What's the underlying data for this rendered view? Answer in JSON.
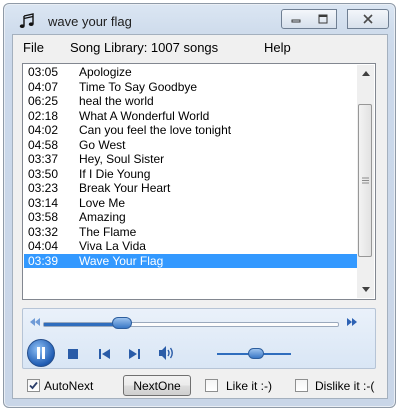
{
  "window": {
    "title": "wave your flag",
    "app_icon": "music-notes-icon"
  },
  "menu": {
    "file": "File",
    "song_library": "Song Library: 1007 songs",
    "help": "Help"
  },
  "playlist": {
    "rows": [
      {
        "duration": "03:05",
        "title": "Apologize"
      },
      {
        "duration": "04:07",
        "title": "Time To Say Goodbye"
      },
      {
        "duration": "06:25",
        "title": "heal the world"
      },
      {
        "duration": "02:18",
        "title": "What A Wonderful World"
      },
      {
        "duration": "04:02",
        "title": "Can you feel the love tonight"
      },
      {
        "duration": "04:58",
        "title": "Go West"
      },
      {
        "duration": "03:37",
        "title": "Hey, Soul Sister"
      },
      {
        "duration": "03:50",
        "title": "If I Die Young"
      },
      {
        "duration": "03:23",
        "title": "Break Your Heart"
      },
      {
        "duration": "03:14",
        "title": "Love Me"
      },
      {
        "duration": "03:58",
        "title": "Amazing"
      },
      {
        "duration": "03:32",
        "title": "The Flame"
      },
      {
        "duration": "04:04",
        "title": "Viva La Vida"
      },
      {
        "duration": "03:39",
        "title": "Wave Your Flag"
      }
    ],
    "selected_index": 13,
    "selection_color": "#3399ff"
  },
  "player": {
    "seek_progress": 0.27,
    "volume_level": 0.5,
    "icons": [
      "rewind-icon",
      "fast-forward-icon",
      "pause-icon",
      "stop-icon",
      "previous-track-icon",
      "next-track-icon",
      "speaker-icon"
    ],
    "accent_color": "#2f6dbd"
  },
  "bottom": {
    "autonext_label": "AutoNext",
    "autonext_checked": true,
    "nextone_label": "NextOne",
    "like_label": "Like it :-)",
    "like_checked": false,
    "dislike_label": "Dislike it :-(",
    "dislike_checked": false
  }
}
